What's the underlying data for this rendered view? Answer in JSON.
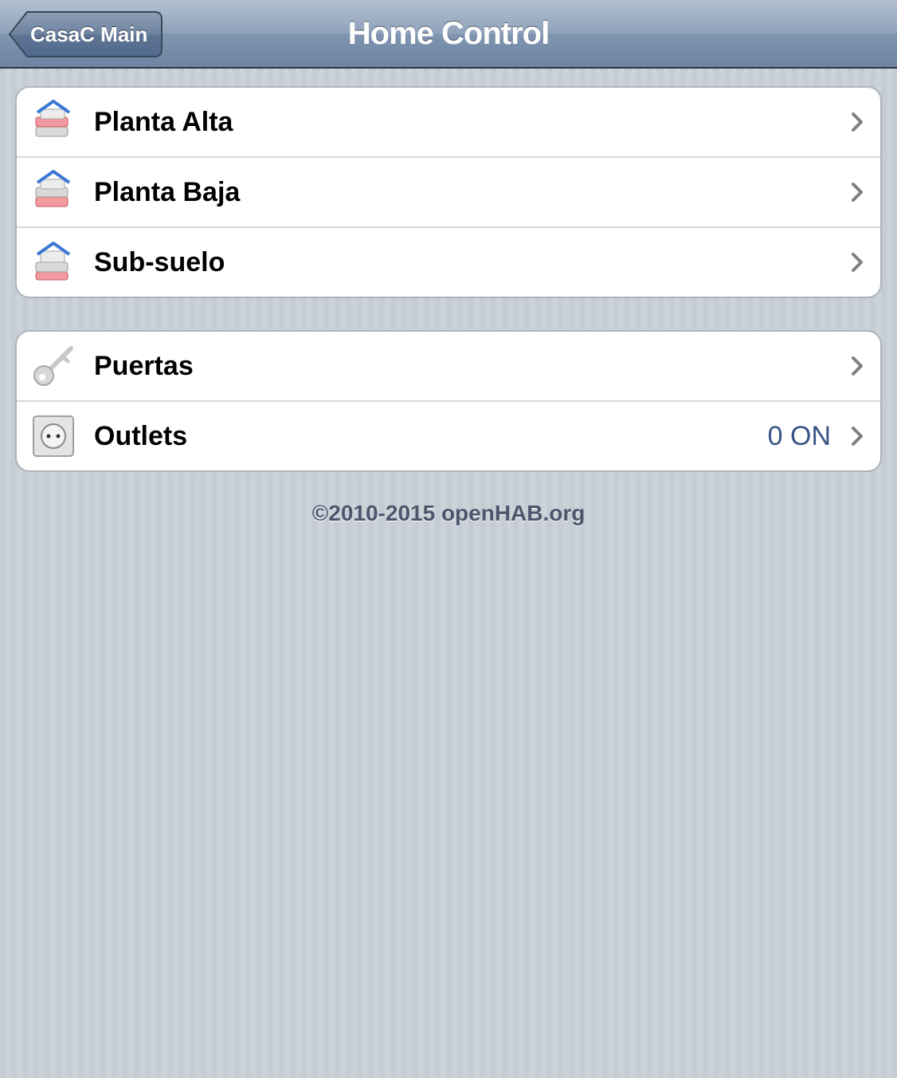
{
  "navbar": {
    "back_label": "CasaC Main",
    "title": "Home Control"
  },
  "groups": [
    {
      "items": [
        {
          "label": "Planta Alta",
          "icon": "house-stack-icon"
        },
        {
          "label": "Planta Baja",
          "icon": "house-stack-icon"
        },
        {
          "label": "Sub-suelo",
          "icon": "house-stack-icon"
        }
      ]
    },
    {
      "items": [
        {
          "label": "Puertas",
          "icon": "key-icon"
        },
        {
          "label": "Outlets",
          "icon": "outlet-icon",
          "value": "0 ON"
        }
      ]
    }
  ],
  "footer": {
    "text": "©2010-2015 openHAB.org"
  },
  "colors": {
    "navbar": "#7f95b0",
    "background": "#c5ccd4",
    "value_text": "#385487"
  }
}
